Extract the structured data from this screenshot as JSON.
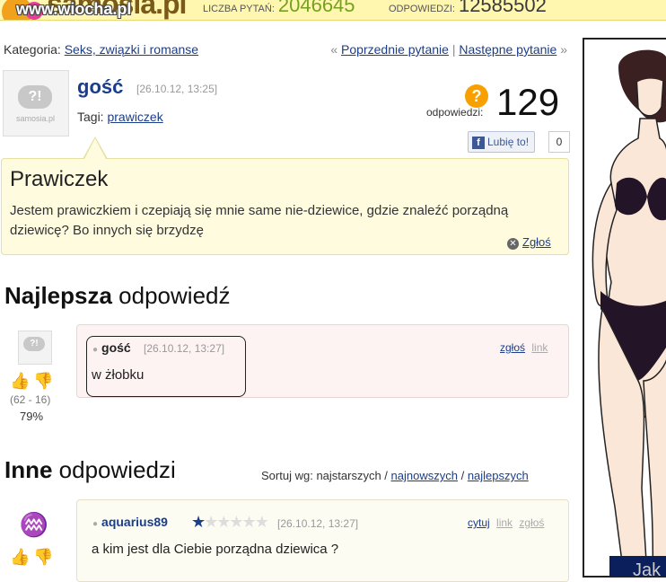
{
  "header": {
    "logo_text": "samosia.pl",
    "watermark": "www.wiocha.pl",
    "stat1_label": "LICZBA PYTAŃ:",
    "stat1_value": "2046645",
    "stat2_label": "ODPOWIEDZI:",
    "stat2_value": "12585502"
  },
  "category": {
    "label": "Kategoria:",
    "value": "Seks, związki i romanse"
  },
  "nav": {
    "prev": "Poprzednie pytanie",
    "sep": "|",
    "next": "Następne pytanie",
    "prev_arrow": "«",
    "next_arrow": "»"
  },
  "question": {
    "avatar_label": "samosia.pl",
    "author": "gość",
    "date": "[26.10.12, 13:25]",
    "tags_label": "Tagi:",
    "tag": "prawiczek",
    "answers_label": "odpowiedzi:",
    "answers_count": "129",
    "like_label": "Lubię to!",
    "like_count": "0",
    "title": "Prawiczek",
    "text": "Jestem prawiczkiem i czepiają się mnie same nie-dziewice, gdzie znaleźć porządną dziewicę? Bo innych się brzydzę",
    "report": "Zgłoś"
  },
  "best_answer": {
    "heading_bold": "Najlepsza",
    "heading_rest": " odpowiedź",
    "author": "gość",
    "date": "[26.10.12, 13:27]",
    "text": "w żłobku",
    "report": "zgłoś",
    "link": "link",
    "votes": "(62 - 16)",
    "percent": "79%"
  },
  "other_answers": {
    "heading_bold": "Inne",
    "heading_rest": " odpowiedzi",
    "sort_label": "Sortuj wg:",
    "sort_oldest": "najstarszych",
    "sort_newest": "najnowszych",
    "sort_best": "najlepszych",
    "items": [
      {
        "author": "aquarius89",
        "date": "[26.10.12, 13:27]",
        "text": "a kim jest dla Ciebie porządna dziewica ?",
        "quote": "cytuj",
        "link": "link",
        "report": "zgłoś",
        "rating": 1
      }
    ]
  },
  "ad": {
    "text": "Jak"
  },
  "icons": [
    "question-icon",
    "facebook-icon",
    "close-circle-icon",
    "thumbs-up-icon",
    "thumbs-down-icon",
    "aquarius-icon",
    "star-icon"
  ]
}
